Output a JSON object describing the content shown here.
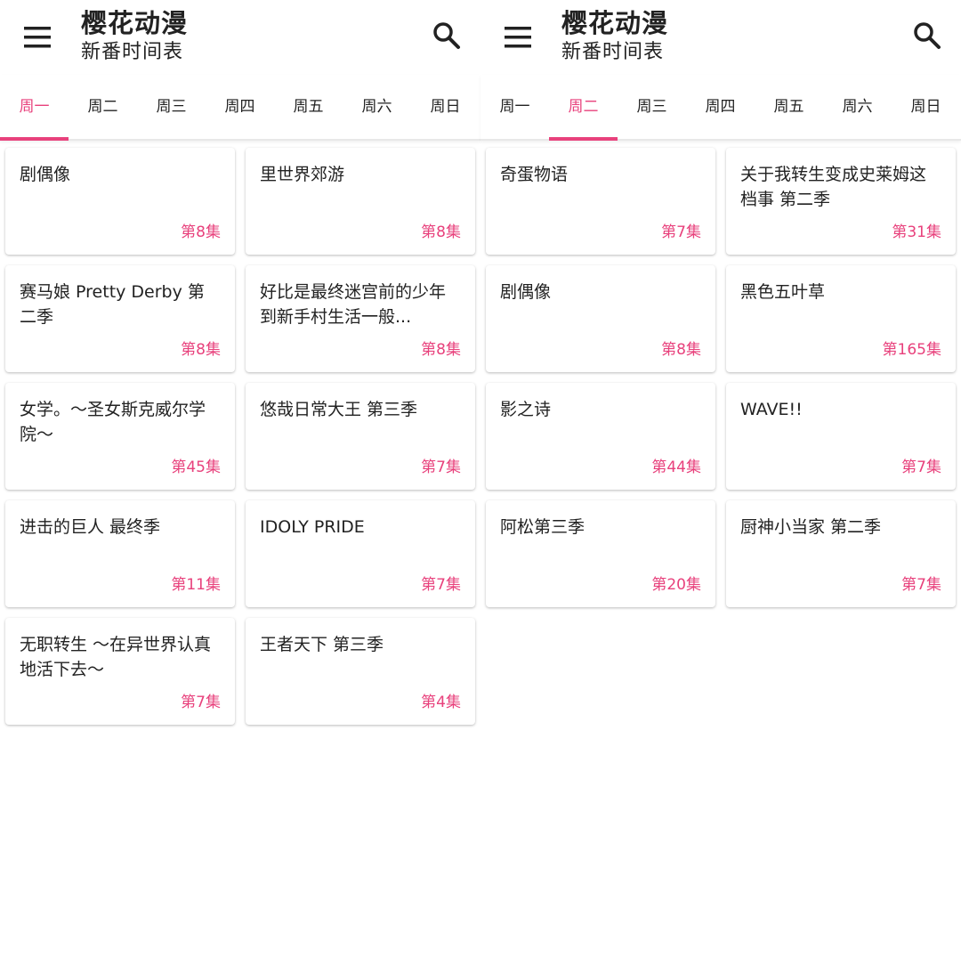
{
  "panels": [
    {
      "title": "樱花动漫",
      "subtitle": "新番时间表",
      "tabs": [
        "周一",
        "周二",
        "周三",
        "周四",
        "周五",
        "周六",
        "周日"
      ],
      "active_tab": 0,
      "items": [
        {
          "title": "剧偶像",
          "episode": "第8集"
        },
        {
          "title": "里世界郊游",
          "episode": "第8集"
        },
        {
          "title": "赛马娘 Pretty Derby 第二季",
          "episode": "第8集"
        },
        {
          "title": "好比是最终迷宫前的少年到新手村生活一般...",
          "episode": "第8集"
        },
        {
          "title": "女学。～圣女斯克威尔学院～",
          "episode": "第45集"
        },
        {
          "title": "悠哉日常大王 第三季",
          "episode": "第7集"
        },
        {
          "title": "进击的巨人 最终季",
          "episode": "第11集"
        },
        {
          "title": "IDOLY PRIDE",
          "episode": "第7集"
        },
        {
          "title": "无职转生 ～在异世界认真地活下去～",
          "episode": "第7集"
        },
        {
          "title": "王者天下 第三季",
          "episode": "第4集"
        }
      ]
    },
    {
      "title": "樱花动漫",
      "subtitle": "新番时间表",
      "tabs": [
        "周一",
        "周二",
        "周三",
        "周四",
        "周五",
        "周六",
        "周日"
      ],
      "active_tab": 1,
      "items": [
        {
          "title": "奇蛋物语",
          "episode": "第7集"
        },
        {
          "title": "关于我转生变成史莱姆这档事 第二季",
          "episode": "第31集"
        },
        {
          "title": "剧偶像",
          "episode": "第8集"
        },
        {
          "title": "黑色五叶草",
          "episode": "第165集"
        },
        {
          "title": "影之诗",
          "episode": "第44集"
        },
        {
          "title": "WAVE!!",
          "episode": "第7集"
        },
        {
          "title": "阿松第三季",
          "episode": "第20集"
        },
        {
          "title": "厨神小当家 第二季",
          "episode": "第7集"
        }
      ]
    }
  ],
  "colors": {
    "accent": "#e8417c",
    "text": "#222222",
    "background": "#ffffff"
  },
  "icons": {
    "menu": "menu-icon",
    "search": "search-icon"
  }
}
